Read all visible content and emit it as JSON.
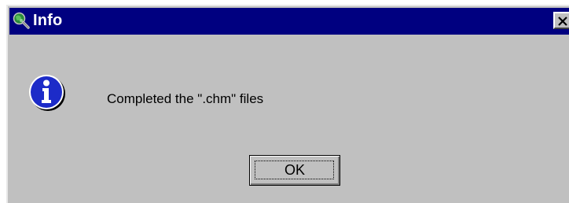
{
  "window": {
    "title": "Info",
    "title_icon": "magnifier-globe-icon",
    "close_icon": "close-icon"
  },
  "body": {
    "icon": "info-icon",
    "message": "Completed the \".chm\" files"
  },
  "buttons": {
    "ok_label": "OK"
  },
  "colors": {
    "titlebar": "#000080",
    "dialog_bg": "#c0c0c0",
    "info_icon_fill": "#1c2bc8"
  }
}
